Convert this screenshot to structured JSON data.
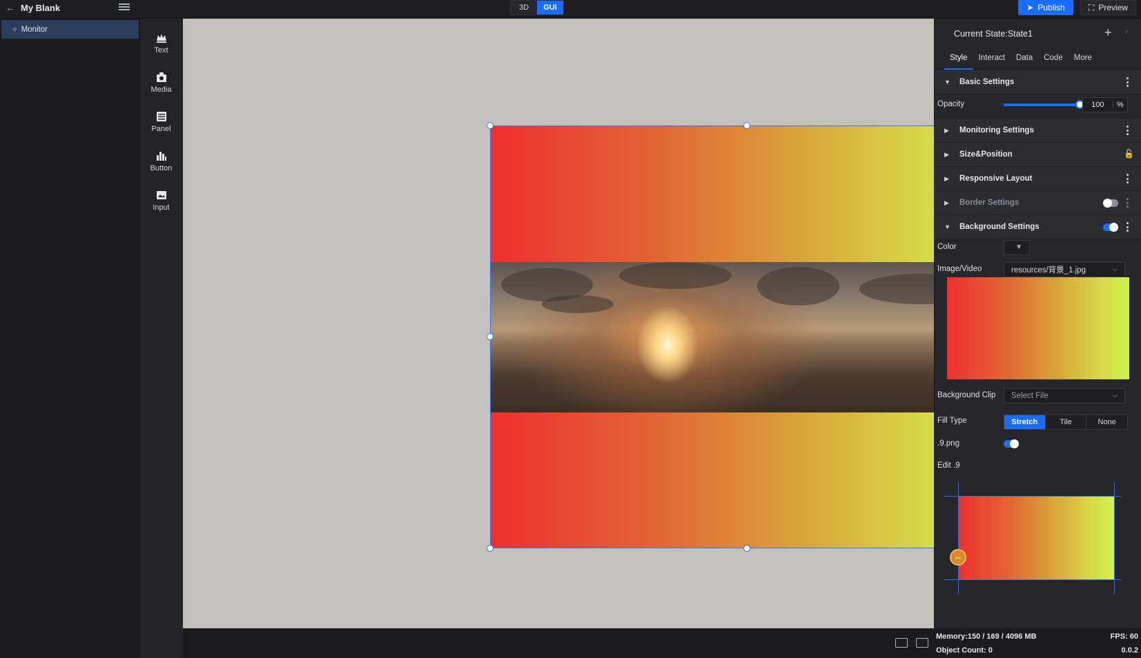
{
  "app": {
    "title": "My Blank",
    "mode_3d": "3D",
    "mode_gui": "GUI",
    "publish": "Publish",
    "preview": "Preview"
  },
  "tree": {
    "items": [
      {
        "label": "Monitor"
      }
    ]
  },
  "components": [
    {
      "label": "Text",
      "icon": "text-icon"
    },
    {
      "label": "Media",
      "icon": "media-icon"
    },
    {
      "label": "Panel",
      "icon": "panel-icon"
    },
    {
      "label": "Button",
      "icon": "button-icon"
    },
    {
      "label": "Input",
      "icon": "input-icon"
    }
  ],
  "inspector": {
    "state_label": "Current State:State1",
    "tabs": [
      "Style",
      "Interact",
      "Data",
      "Code",
      "More"
    ],
    "sections": {
      "basic": "Basic Settings",
      "monitoring": "Monitoring Settings",
      "size_position": "Size&Position",
      "responsive": "Responsive Layout",
      "border": "Border Settings",
      "background": "Background Settings"
    },
    "opacity": {
      "label": "Opacity",
      "value": "100",
      "unit": "%"
    },
    "color_label": "Color",
    "image_video": {
      "label": "Image/Video",
      "value": "resources/背景_1.jpg"
    },
    "background_clip": {
      "label": "Background Clip",
      "placeholder": "Select File"
    },
    "fill_type": {
      "label": "Fill Type",
      "options": [
        "Stretch",
        "Tile",
        "None"
      ],
      "selected": "Stretch"
    },
    "nine_png_label": ".9.png",
    "edit_nine_label": "Edit .9"
  },
  "status": {
    "memory": "Memory:150 / 169 / 4096 MB",
    "fps": "FPS: 60",
    "object_count": "Object Count: 0",
    "version": "0.0.2"
  },
  "colors": {
    "accent": "#1a6dff",
    "selection": "#2f74ff"
  }
}
